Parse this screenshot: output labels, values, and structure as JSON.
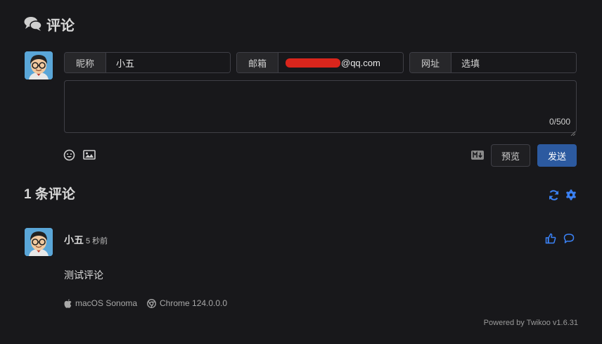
{
  "header": {
    "title": "评论",
    "icon": "comments-icon"
  },
  "form": {
    "nickname": {
      "label": "昵称",
      "value": "小五"
    },
    "email": {
      "label": "邮箱",
      "value_suffix": "@qq.com"
    },
    "website": {
      "label": "网址",
      "placeholder": "选填"
    },
    "counter": "0/500",
    "preview_label": "预览",
    "send_label": "发送"
  },
  "comments_header": {
    "count_title": "1 条评论"
  },
  "comment": {
    "author": "小五",
    "time": "5 秒前",
    "text": "测试评论",
    "os": "macOS Sonoma",
    "browser": "Chrome 124.0.0.0"
  },
  "footer": {
    "powered": "Powered by Twikoo v1.6.31"
  },
  "colors": {
    "background": "#18181b",
    "accent": "#3b82f6",
    "send_button": "#2c5aa0",
    "redaction": "#d9251c"
  }
}
